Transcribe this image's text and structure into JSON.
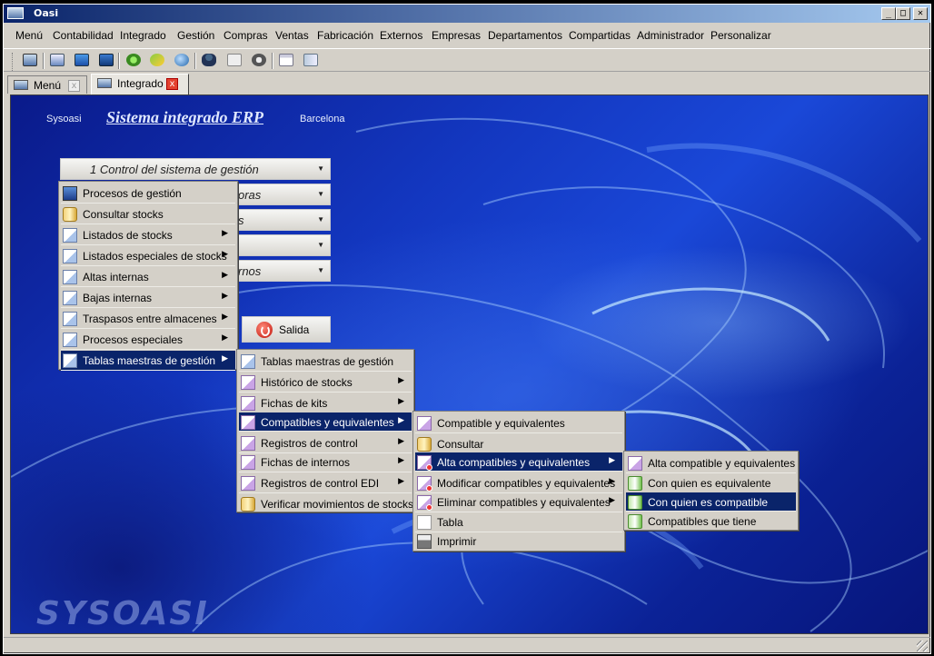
{
  "window": {
    "title": "Oasi",
    "minimize": "_",
    "maximize": "□",
    "close": "✕"
  },
  "menubar": [
    "Menú",
    "Contabilidad",
    "Integrado",
    "Gestión",
    "Compras",
    "Ventas",
    "Fabricación",
    "Externos",
    "Empresas",
    "Departamentos",
    "Compartidas",
    "Administrador",
    "Personalizar"
  ],
  "toolbar_icons": [
    "desktop-icon",
    "window-icon",
    "monitor-icon",
    "monitor-dark-icon",
    "gear-icon",
    "recycle-icon",
    "globe-icon",
    "user-icon",
    "notepad-icon",
    "info-icon",
    "calendar-icon",
    "book-icon"
  ],
  "tabs": [
    {
      "label": "Menú",
      "close": "x"
    },
    {
      "label": "Integrado",
      "close": "x"
    }
  ],
  "header": {
    "company": "Sysoasi",
    "title": "Sistema integrado ERP",
    "city": "Barcelona"
  },
  "combos": [
    {
      "label": "1  Control del sistema de gestión"
    },
    {
      "label": "oras"
    },
    {
      "label": "s"
    },
    {
      "label": ""
    },
    {
      "label": "rnos"
    }
  ],
  "salida": {
    "label": "Salida"
  },
  "logo": "SYSOASI",
  "menu1": [
    {
      "label": "Procesos de gestión",
      "icon": "monitor",
      "submenu": false
    },
    {
      "label": "Consultar stocks",
      "icon": "cyl",
      "submenu": false
    },
    {
      "label": "Listados de stocks",
      "icon": "doc",
      "submenu": true
    },
    {
      "label": "Listados especiales de stocks",
      "icon": "doc",
      "submenu": true
    },
    {
      "label": "Altas internas",
      "icon": "doc",
      "submenu": true
    },
    {
      "label": "Bajas internas",
      "icon": "doc",
      "submenu": true
    },
    {
      "label": "Traspasos entre almacenes",
      "icon": "doc",
      "submenu": true
    },
    {
      "label": "Procesos especiales",
      "icon": "doc",
      "submenu": true
    },
    {
      "label": "Tablas maestras de gestión",
      "icon": "doc",
      "submenu": true,
      "selected": true
    }
  ],
  "menu2": [
    {
      "label": "Tablas maestras de gestión",
      "icon": "doc",
      "submenu": false
    },
    {
      "label": "Histórico de stocks",
      "icon": "docp",
      "submenu": true
    },
    {
      "label": "Fichas de kits",
      "icon": "docp",
      "submenu": true
    },
    {
      "label": "Compatibles y equivalentes",
      "icon": "docp",
      "submenu": true,
      "selected": true
    },
    {
      "label": "Registros de control",
      "icon": "docp",
      "submenu": true
    },
    {
      "label": "Fichas de internos",
      "icon": "docp",
      "submenu": true
    },
    {
      "label": "Registros de control EDI",
      "icon": "docp",
      "submenu": true
    },
    {
      "label": "Verificar movimientos de stocks",
      "icon": "cyl",
      "submenu": false
    }
  ],
  "menu3": [
    {
      "label": "Compatible y equivalentes",
      "icon": "docp",
      "submenu": false
    },
    {
      "label": "Consultar",
      "icon": "cyl",
      "submenu": false
    },
    {
      "label": "Alta compatibles y equivalentes",
      "icon": "alta",
      "submenu": true,
      "selected": true
    },
    {
      "label": "Modificar compatibles y equivalentes",
      "icon": "alta",
      "submenu": true
    },
    {
      "label": "Eliminar compatibles y equivalentes",
      "icon": "alta",
      "submenu": true
    },
    {
      "label": "Tabla",
      "icon": "sheet",
      "submenu": false
    },
    {
      "label": "Imprimir",
      "icon": "printer",
      "submenu": false
    }
  ],
  "menu4": [
    {
      "label": "Alta compatible y equivalentes",
      "icon": "docp",
      "submenu": false
    },
    {
      "label": "Con quien es equivalente",
      "icon": "green",
      "submenu": false
    },
    {
      "label": "Con quien es compatible",
      "icon": "green",
      "submenu": false,
      "selected": true
    },
    {
      "label": "Compatibles que tiene",
      "icon": "green",
      "submenu": false
    }
  ],
  "colors": {
    "selection": "#0a246a",
    "desktop": "#1337c0",
    "chrome": "#d4d0c8"
  }
}
